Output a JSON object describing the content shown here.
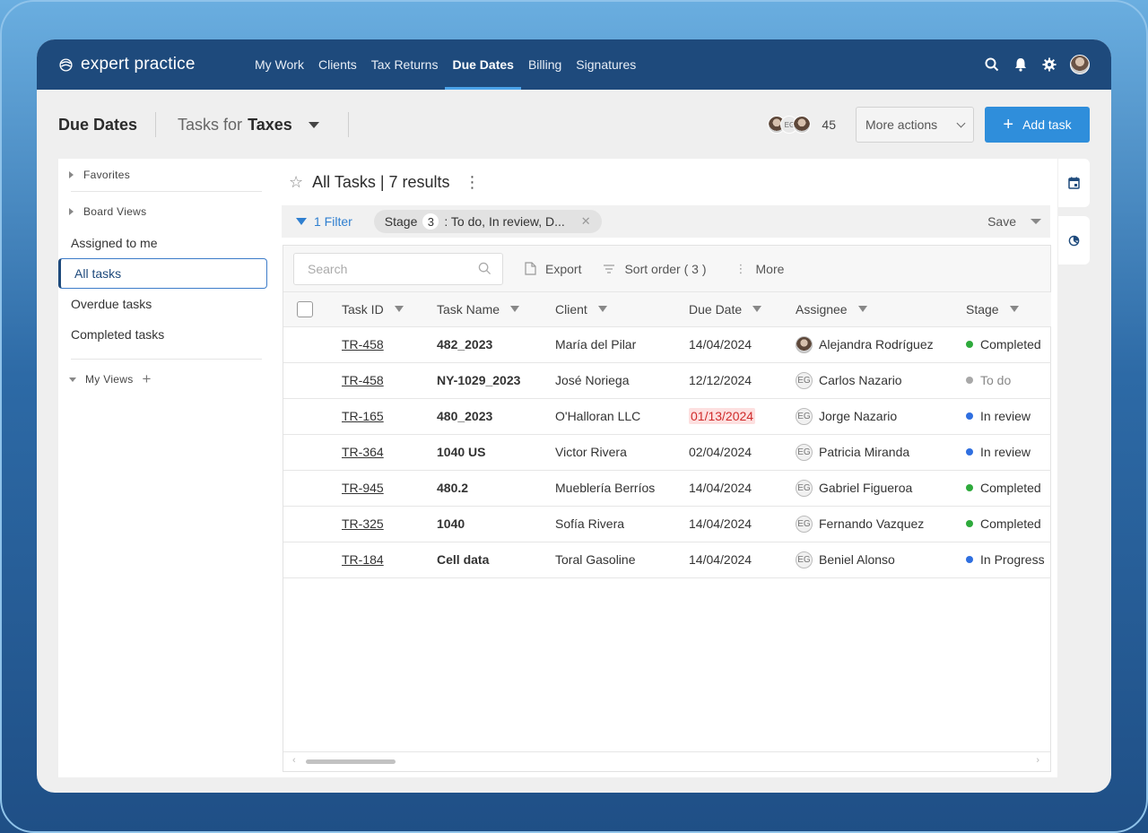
{
  "nav": {
    "logo_text": "expert practice",
    "links": [
      "My Work",
      "Clients",
      "Tax Returns",
      "Due Dates",
      "Billing",
      "Signatures"
    ],
    "active": "Due Dates",
    "icons": [
      "search-icon",
      "bell-icon",
      "gear-icon",
      "user-avatar"
    ]
  },
  "header": {
    "title": "Due Dates",
    "tasks_for_prefix": "Tasks for",
    "tasks_for_value": "Taxes",
    "avatars": [
      "photo",
      "EG",
      "photo"
    ],
    "avatar_initials": "EG",
    "member_count": "45",
    "more_actions": "More actions",
    "add_task": "Add task"
  },
  "sidebar": {
    "favorites": "Favorites",
    "board_views": "Board Views",
    "items": [
      "Assigned to me",
      "All tasks",
      "Overdue tasks",
      "Completed tasks"
    ],
    "active_item": "All tasks",
    "my_views": "My Views"
  },
  "main": {
    "title": "All Tasks | 7 results",
    "filter_label": "1 Filter",
    "chip": {
      "name": "Stage",
      "count": "3",
      "value": ": To do, In review, D..."
    },
    "save_label": "Save",
    "toolbar": {
      "search_placeholder": "Search",
      "export": "Export",
      "sort": "Sort order ( 3 )",
      "more": "More"
    },
    "columns": [
      "Task ID",
      "Task Name",
      "Client",
      "Due Date",
      "Assignee",
      "Stage"
    ],
    "rows": [
      {
        "id": "TR-458",
        "name": "482_2023",
        "client": "María del Pilar",
        "due": "14/04/2024",
        "overdue": false,
        "assignee": "Alejandra Rodríguez",
        "avatar": "photo",
        "stage": "Completed",
        "stage_color": "#2eaa3c"
      },
      {
        "id": "TR-458",
        "name": "NY-1029_2023",
        "client": "José Noriega",
        "due": "12/12/2024",
        "overdue": false,
        "assignee": "Carlos Nazario",
        "avatar": "EG",
        "stage": "To do",
        "stage_color": "#a8a8a8"
      },
      {
        "id": "TR-165",
        "name": "480_2023",
        "client": "O'Halloran LLC",
        "due": "01/13/2024",
        "overdue": true,
        "assignee": "Jorge Nazario",
        "avatar": "EG",
        "stage": "In review",
        "stage_color": "#2f6fe0"
      },
      {
        "id": "TR-364",
        "name": "1040 US",
        "client": "Victor Rivera",
        "due": "02/04/2024",
        "overdue": false,
        "assignee": "Patricia Miranda",
        "avatar": "EG",
        "stage": "In review",
        "stage_color": "#2f6fe0"
      },
      {
        "id": "TR-945",
        "name": "480.2",
        "client": "Mueblería Berríos",
        "due": "14/04/2024",
        "overdue": false,
        "assignee": "Gabriel Figueroa",
        "avatar": "EG",
        "stage": "Completed",
        "stage_color": "#2eaa3c"
      },
      {
        "id": "TR-325",
        "name": "1040",
        "client": "Sofía Rivera",
        "due": "14/04/2024",
        "overdue": false,
        "assignee": "Fernando Vazquez",
        "avatar": "EG",
        "stage": "Completed",
        "stage_color": "#2eaa3c"
      },
      {
        "id": "TR-184",
        "name": "Cell data",
        "client": "Toral Gasoline",
        "due": "14/04/2024",
        "overdue": false,
        "assignee": "Beniel Alonso",
        "avatar": "EG",
        "stage": "In Progress",
        "stage_color": "#2f6fe0"
      }
    ]
  },
  "rail": {
    "icons": [
      "calendar-icon",
      "chart-icon"
    ]
  },
  "colors": {
    "nav_bg": "#1e4a7c",
    "accent": "#2f8edb",
    "overdue_bg": "#fde0e0",
    "overdue_text": "#d02b2b"
  }
}
